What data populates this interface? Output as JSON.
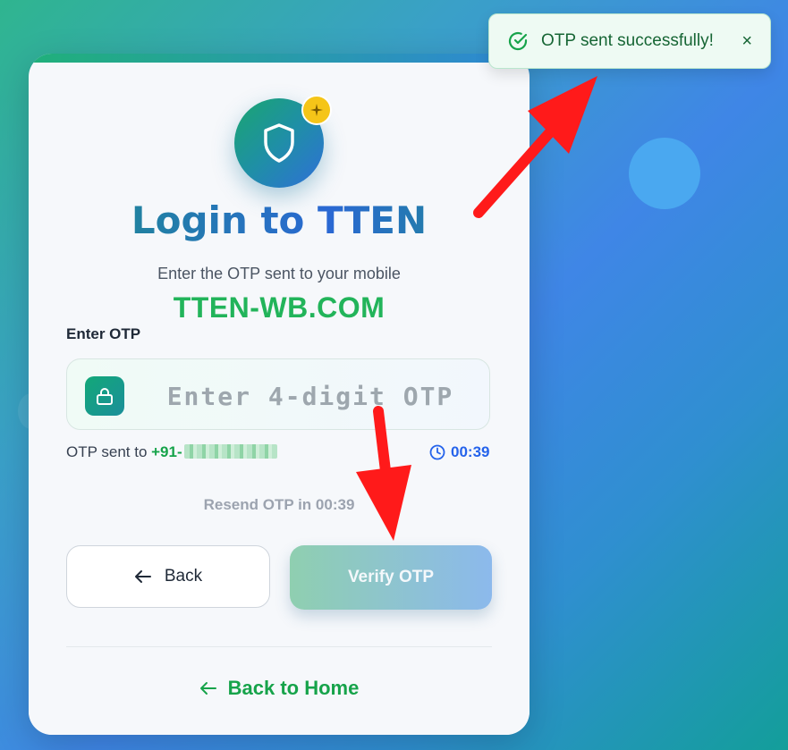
{
  "toast": {
    "message": "OTP sent successfully!",
    "close": "×"
  },
  "login": {
    "title": "Login to TTEN",
    "subtitle": "Enter the OTP sent to your mobile",
    "watermark": "TTEN-WB.COM",
    "otp_label": "Enter OTP",
    "otp_placeholder": "Enter 4-digit OTP",
    "otp_value": "",
    "sent_prefix": "OTP sent to ",
    "phone_prefix": "+91-",
    "timer": "00:39",
    "resend": "Resend OTP in 00:39",
    "back_label": "Back",
    "verify_label": "Verify OTP",
    "home_label": "Back to Home"
  },
  "colors": {
    "accent_green": "#16a34a",
    "accent_blue": "#2563eb",
    "arrow_red": "#ff0000"
  },
  "icons": [
    "check-circle-icon",
    "close-icon",
    "shield-icon",
    "sparkle-icon",
    "lock-icon",
    "clock-icon",
    "arrow-left-icon"
  ]
}
